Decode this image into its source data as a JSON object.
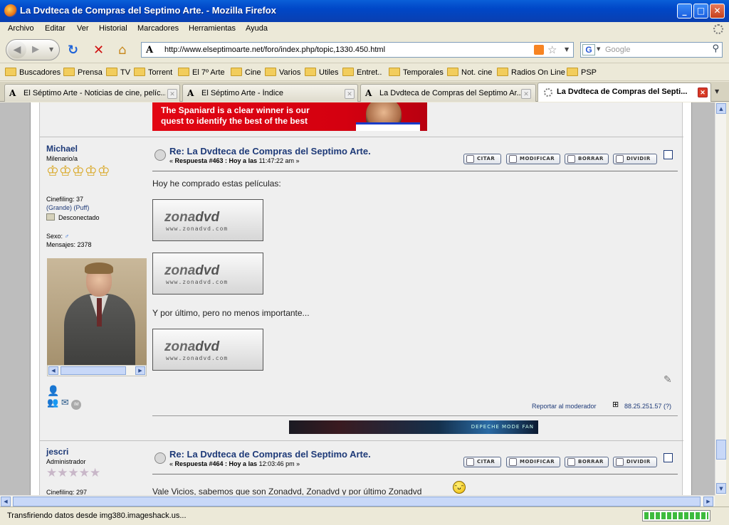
{
  "window": {
    "title": "La Dvdteca de Compras del Septimo Arte. - Mozilla Firefox"
  },
  "menu": [
    "Archivo",
    "Editar",
    "Ver",
    "Historial",
    "Marcadores",
    "Herramientas",
    "Ayuda"
  ],
  "nav": {
    "url": "http://www.elseptimoarte.net/foro/index.php/topic,1330.450.html",
    "search_engine": "G",
    "search_placeholder": "Google"
  },
  "bookmarks": [
    "Buscadores",
    "Prensa",
    "TV",
    "Torrent",
    "El 7º Arte",
    "Cine",
    "Varios",
    "Utiles",
    "Entret..",
    "Temporales",
    "Not. cine",
    "Radios On Line",
    "PSP"
  ],
  "tabs": [
    {
      "label": "El Séptimo Arte - Noticias de cine, pelíc..."
    },
    {
      "label": "El Séptimo Arte - Índice"
    },
    {
      "label": "La Dvdteca de Compras del Septimo Ar..."
    },
    {
      "label": "La Dvdteca de Compras del Septi..."
    }
  ],
  "banner": {
    "line1": "The Spaniard is a clear winner is our",
    "line2": "quest to identify the best of the best"
  },
  "post1": {
    "author": "Michael",
    "role": "Milenario/a",
    "stars": "♔♔♔♔♔",
    "cinefiling": "Cinefiling: 37",
    "grande_puff": "(Grande) (Puff)",
    "status": "Desconectado",
    "sexo": "Sexo:",
    "mensajes": "Mensajes: 2378",
    "title": "Re: La Dvdteca de Compras del Septimo Arte.",
    "meta_prefix": "« ",
    "meta_bold": "Respuesta #463 : Hoy a las",
    "meta_time": " 11:47:22 am »",
    "buttons": [
      "CITAR",
      "MODIFICAR",
      "BORRAR",
      "DIVIDIR"
    ],
    "body1": "Hoy he comprado estas películas:",
    "body2": "Y por último, pero no menos importante...",
    "report": "Reportar al moderador",
    "ip": "88.25.251.57 (?)",
    "signature": "DEPECHE MODE FAN"
  },
  "zonadvd": {
    "logo_a": "zona",
    "logo_b": "dvd",
    "url": "www.zonadvd.com"
  },
  "post2": {
    "author": "jescri",
    "role": "Administrador",
    "stars": "★★★★★",
    "cinefiling": "Cinefiling: 297",
    "title": "Re: La Dvdteca de Compras del Septimo Arte.",
    "meta_prefix": "« ",
    "meta_bold": "Respuesta #464 : Hoy a las",
    "meta_time": " 12:03:46 pm »",
    "buttons": [
      "CITAR",
      "MODIFICAR",
      "BORRAR",
      "DIVIDIR"
    ],
    "body1": "Vale Vicios, sabemos que son Zonadvd, Zonadvd y por último Zonadvd"
  },
  "status": {
    "text": "Transfiriendo datos desde img380.imageshack.us...",
    "progress": 1.0
  }
}
